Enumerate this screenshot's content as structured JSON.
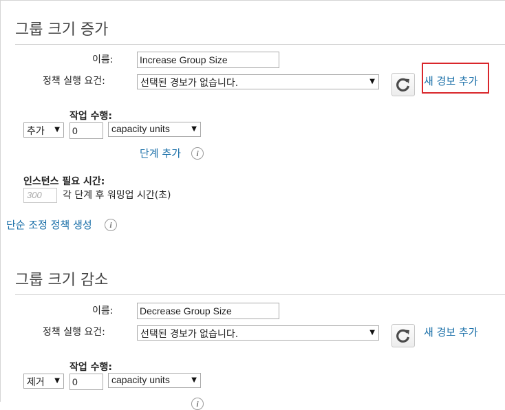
{
  "increase": {
    "title": "그룹 크기 증가",
    "name_label": "이름:",
    "name_value": "Increase Group Size",
    "condition_label": "정책 실행 요건:",
    "alarm_select": "선택된 경보가 없습니다.",
    "add_alarm_link": "새 경보 추가",
    "action_label": "작업 수행:",
    "action_select": "추가",
    "action_value": "0",
    "unit_select": "capacity units",
    "add_step_link": "단계 추가",
    "warmup_label": "인스턴스 필요 시간:",
    "warmup_placeholder": "300",
    "warmup_suffix": "각 단계 후 워밍업 시간(초)",
    "simple_policy_link": "단순 조정 정책 생성"
  },
  "decrease": {
    "title": "그룹 크기 감소",
    "name_label": "이름:",
    "name_value": "Decrease Group Size",
    "condition_label": "정책 실행 요건:",
    "alarm_select": "선택된 경보가 없습니다.",
    "add_alarm_link": "새 경보 추가",
    "action_label": "작업 수행:",
    "action_select": "제거",
    "action_value": "0",
    "unit_select": "capacity units"
  },
  "icons": {
    "refresh": "refresh-icon",
    "info": "info-icon",
    "dropdown": "chevron-down-icon"
  },
  "colors": {
    "link": "#1a6fa8",
    "highlight": "#d9262b",
    "divider": "#cfcfcf"
  }
}
